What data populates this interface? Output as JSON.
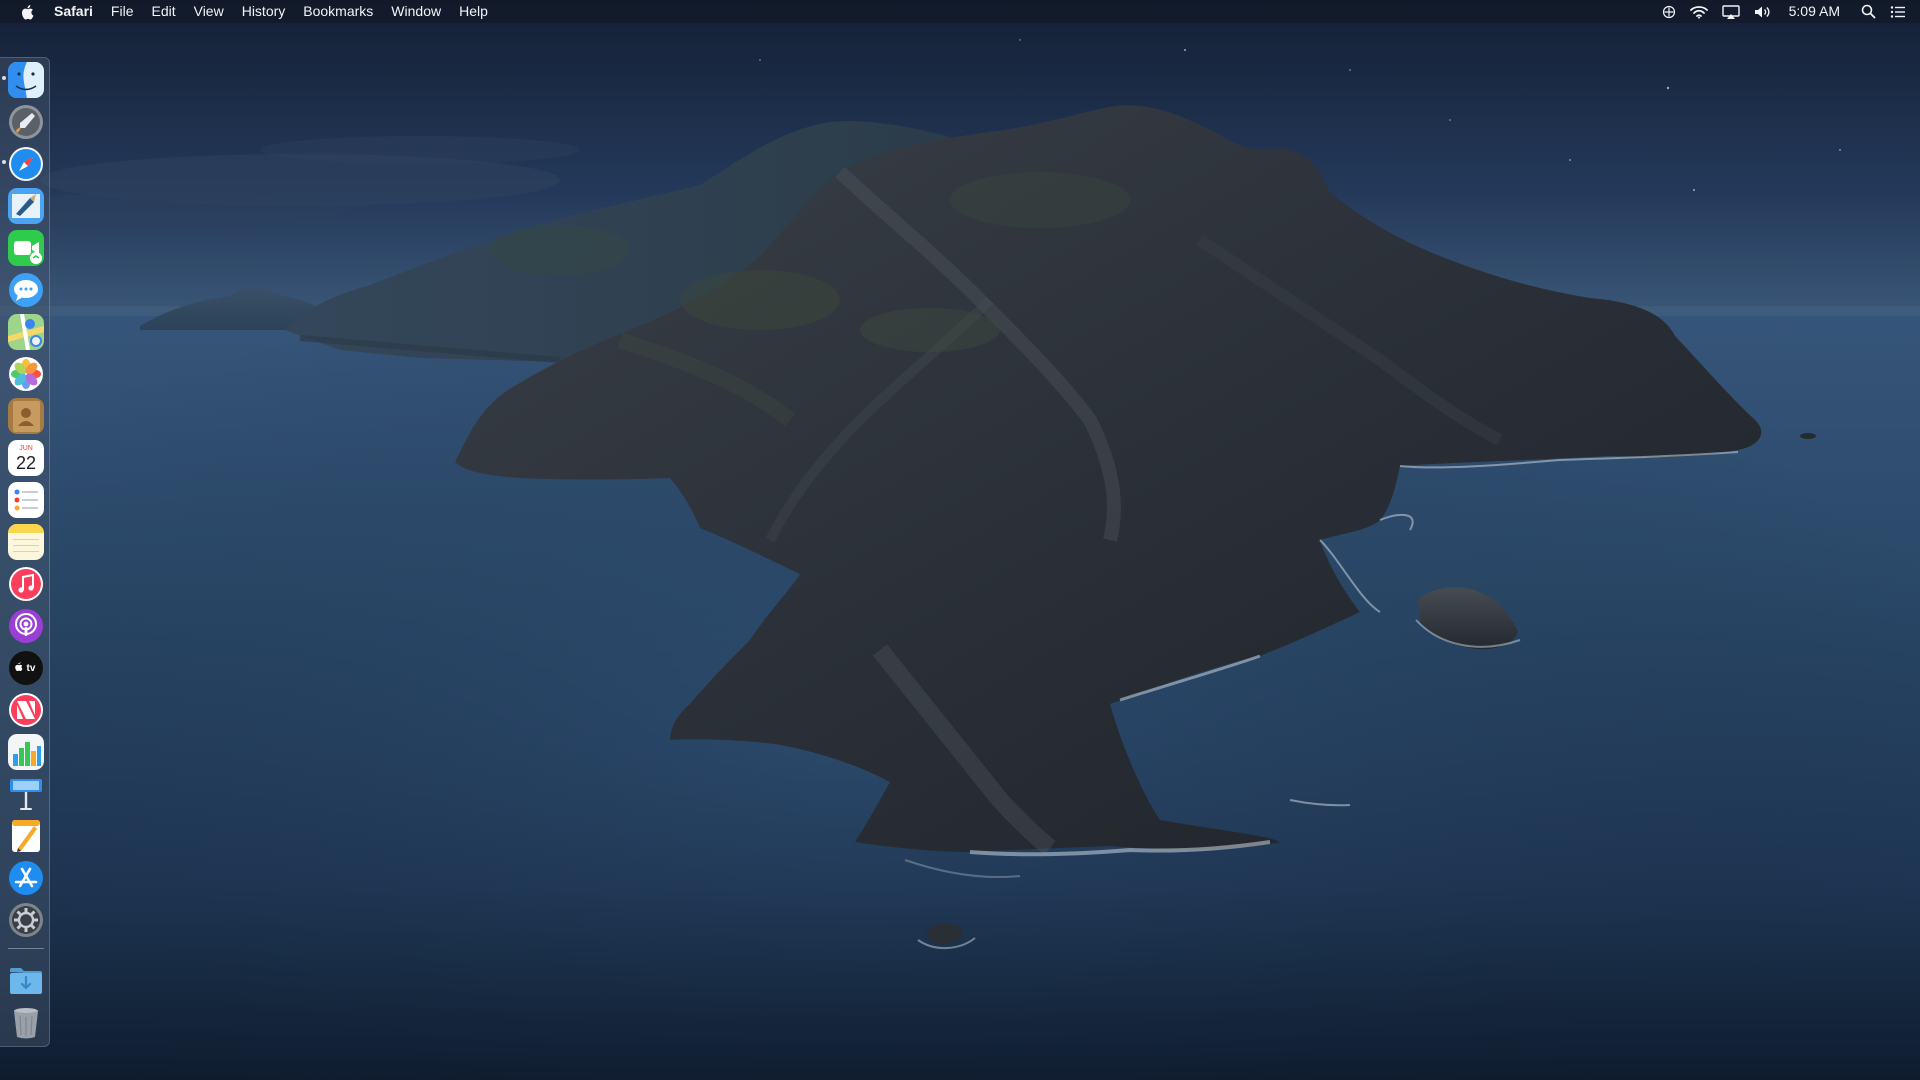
{
  "menubar": {
    "apple_icon": "apple-logo-icon",
    "app_name": "Safari",
    "menus": [
      "File",
      "Edit",
      "View",
      "History",
      "Bookmarks",
      "Window",
      "Help"
    ],
    "status_icons": [
      "accessibility-icon",
      "wifi-icon",
      "airplay-icon",
      "volume-icon"
    ],
    "clock": "5:09 AM",
    "right_icons": [
      "spotlight-search-icon",
      "notification-center-icon"
    ]
  },
  "dock": {
    "apps": [
      {
        "name": "Finder",
        "icon": "finder-icon",
        "running": true
      },
      {
        "name": "Launchpad",
        "icon": "launchpad-icon",
        "running": false
      },
      {
        "name": "Safari",
        "icon": "safari-icon",
        "running": true
      },
      {
        "name": "Mail",
        "icon": "mail-icon",
        "running": false
      },
      {
        "name": "FaceTime",
        "icon": "facetime-icon",
        "running": false
      },
      {
        "name": "Messages",
        "icon": "messages-icon",
        "running": false
      },
      {
        "name": "Maps",
        "icon": "maps-icon",
        "running": false
      },
      {
        "name": "Photos",
        "icon": "photos-icon",
        "running": false
      },
      {
        "name": "Contacts",
        "icon": "contacts-icon",
        "running": false
      },
      {
        "name": "Calendar",
        "icon": "calendar-icon",
        "running": false,
        "month": "JUN",
        "day": "22"
      },
      {
        "name": "Reminders",
        "icon": "reminders-icon",
        "running": false
      },
      {
        "name": "Notes",
        "icon": "notes-icon",
        "running": false
      },
      {
        "name": "Music",
        "icon": "music-icon",
        "running": false
      },
      {
        "name": "Podcasts",
        "icon": "podcasts-icon",
        "running": false
      },
      {
        "name": "TV",
        "icon": "apple-tv-icon",
        "running": false,
        "label": "tv"
      },
      {
        "name": "News",
        "icon": "news-icon",
        "running": false
      },
      {
        "name": "Numbers",
        "icon": "numbers-icon",
        "running": false
      },
      {
        "name": "Keynote",
        "icon": "keynote-icon",
        "running": false
      },
      {
        "name": "Pages",
        "icon": "pages-icon",
        "running": false
      },
      {
        "name": "App Store",
        "icon": "app-store-icon",
        "running": false
      },
      {
        "name": "System Preferences",
        "icon": "system-preferences-icon",
        "running": false
      }
    ],
    "stacks": [
      {
        "name": "Downloads",
        "icon": "downloads-folder-icon"
      },
      {
        "name": "Trash",
        "icon": "trash-icon"
      }
    ]
  },
  "colors": {
    "sky_top": "#16233a",
    "sky_horizon": "#3b5878",
    "sea": "#2a4868",
    "sea_deep": "#0f1c2e",
    "island": "#2b3038",
    "accent": "#2a7ff0"
  }
}
